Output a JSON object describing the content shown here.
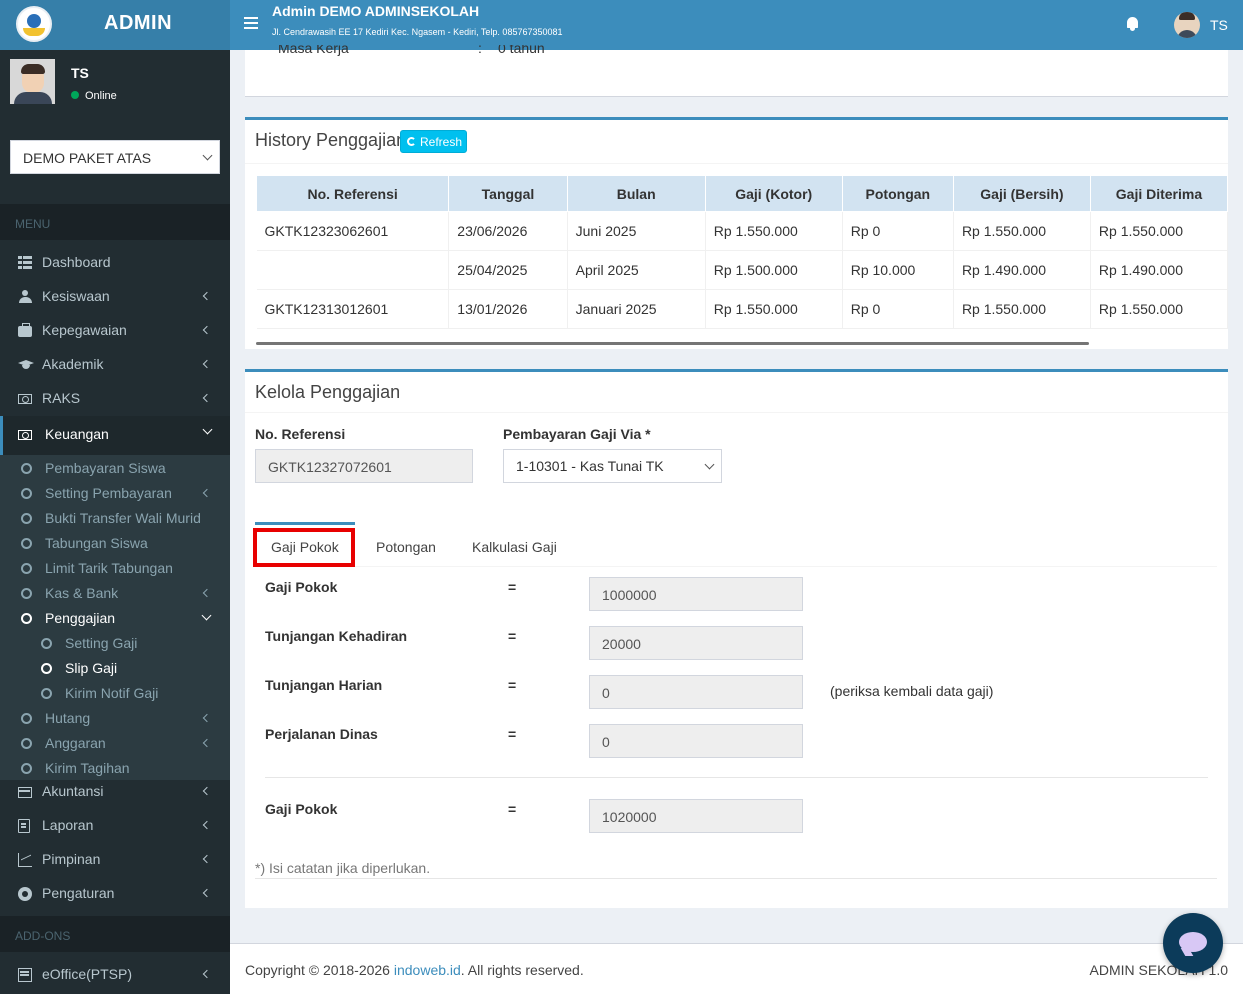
{
  "header": {
    "logo_title": "ADMIN",
    "app_title": "Admin DEMO ADMINSEKOLAH",
    "address": "Jl. Cendrawasih EE 17 Kediri Kec. Ngasem - Kediri, Telp. 085767350081",
    "user_initials": "TS"
  },
  "sidebar": {
    "user_name": "TS",
    "user_status": "Online",
    "school_selected": "DEMO PAKET ATAS",
    "menu_header": "MENU",
    "addons_header": "ADD-ONS",
    "items": [
      {
        "label": "Dashboard"
      },
      {
        "label": "Kesiswaan"
      },
      {
        "label": "Kepegawaian"
      },
      {
        "label": "Akademik"
      },
      {
        "label": "RAKS"
      },
      {
        "label": "Keuangan"
      },
      {
        "label": "Akuntansi"
      },
      {
        "label": "Laporan"
      },
      {
        "label": "Pimpinan"
      },
      {
        "label": "Pengaturan"
      },
      {
        "label": "eOffice(PTSP)"
      }
    ],
    "keuangan_sub": [
      {
        "label": "Pembayaran Siswa"
      },
      {
        "label": "Setting Pembayaran"
      },
      {
        "label": "Bukti Transfer Wali Murid"
      },
      {
        "label": "Tabungan Siswa"
      },
      {
        "label": "Limit Tarik Tabungan"
      },
      {
        "label": "Kas & Bank"
      },
      {
        "label": "Penggajian"
      },
      {
        "label": "Hutang"
      },
      {
        "label": "Anggaran"
      },
      {
        "label": "Kirim Tagihan"
      }
    ],
    "penggajian_sub": [
      {
        "label": "Setting Gaji"
      },
      {
        "label": "Slip Gaji"
      },
      {
        "label": "Kirim Notif Gaji"
      }
    ]
  },
  "top_box": {
    "masa_kerja_label": "Masa Kerja",
    "colon": ":",
    "masa_kerja_value": "0 tahun"
  },
  "history": {
    "title": "History Penggajian",
    "refresh_label": "Refresh",
    "columns": [
      "No. Referensi",
      "Tanggal",
      "Bulan",
      "Gaji (Kotor)",
      "Potongan",
      "Gaji (Bersih)",
      "Gaji Diterima"
    ],
    "rows": [
      [
        "GKTK12323062601",
        "23/06/2026",
        "Juni 2025",
        "Rp 1.550.000",
        "Rp 0",
        "Rp 1.550.000",
        "Rp 1.550.000"
      ],
      [
        "",
        "25/04/2025",
        "April 2025",
        "Rp 1.500.000",
        "Rp 10.000",
        "Rp 1.490.000",
        "Rp 1.490.000"
      ],
      [
        "GKTK12313012601",
        "13/01/2026",
        "Januari 2025",
        "Rp 1.550.000",
        "Rp 0",
        "Rp 1.550.000",
        "Rp 1.550.000"
      ]
    ]
  },
  "kelola": {
    "title": "Kelola Penggajian",
    "no_ref_label": "No. Referensi",
    "no_ref_value": "GKTK12327072601",
    "via_label": "Pembayaran Gaji Via *",
    "via_value": "1-10301 - Kas Tunai TK",
    "tabs": [
      "Gaji Pokok",
      "Potongan",
      "Kalkulasi Gaji"
    ],
    "eq": "=",
    "fields": [
      {
        "label": "Gaji Pokok",
        "value": "1000000"
      },
      {
        "label": "Tunjangan Kehadiran",
        "value": "20000"
      },
      {
        "label": "Tunjangan Harian",
        "value": "0",
        "note": "(periksa kembali data gaji)"
      },
      {
        "label": "Perjalanan Dinas",
        "value": "0"
      }
    ],
    "total_label": "Gaji Pokok",
    "total_value": "1020000",
    "footnote": "*) Isi catatan jika diperlukan."
  },
  "footer": {
    "copyright_prefix": "Copyright © 2018-2026 ",
    "link": "indoweb.id",
    "copyright_suffix": ". All rights reserved.",
    "version": "ADMIN SEKOLAH 1.0"
  }
}
